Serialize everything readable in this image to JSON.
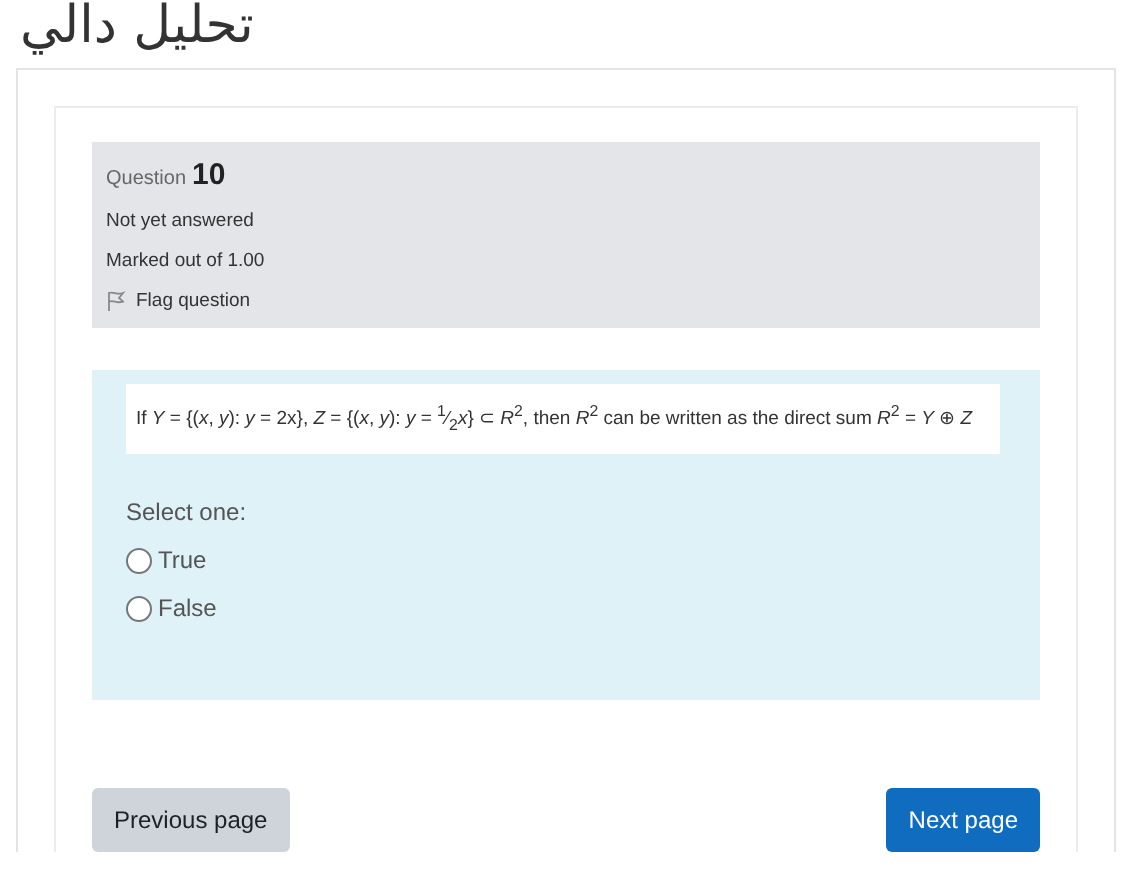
{
  "page_title": "تحليل دالي",
  "info": {
    "question_label": "Question",
    "question_number": "10",
    "status": "Not yet answered",
    "marks": "Marked out of 1.00",
    "flag": {
      "label": "Flag question",
      "flagged": false
    }
  },
  "question": {
    "text": "If *Y* = {(*x*, *y*): *y* = 2x}, *Z* = {(*x*, *y*): *y* = $^{1}$⁄$_{2}$*x*} ⊂ *R*$^{2}$, then *R*$^{2}$ can be written as the direct sum *R*$^{2}$ = *Y* ⊕ *Z*",
    "prompt": "Select one:",
    "options": [
      {
        "label": "True",
        "selected": false
      },
      {
        "label": "False",
        "selected": false
      }
    ]
  },
  "buttons": [
    {
      "label": "Previous page",
      "kind": "secondary"
    },
    {
      "label": "Next page",
      "kind": "primary"
    }
  ]
}
